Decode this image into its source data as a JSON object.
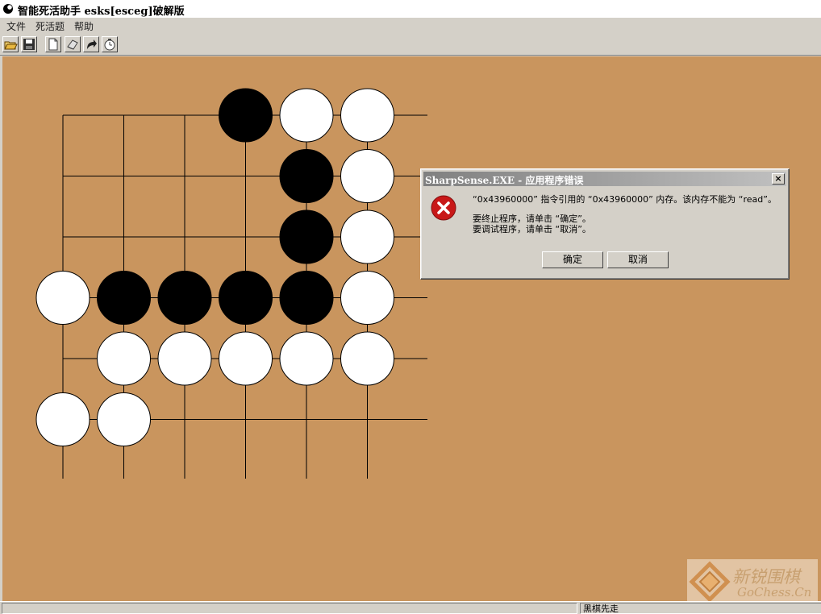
{
  "window": {
    "title": "智能死活助手 esks[esceg]破解版"
  },
  "menu": [
    "文件",
    "死活题",
    "帮助"
  ],
  "toolbar": {
    "buttons": [
      "open-icon",
      "save-icon",
      "new-icon",
      "erase-icon",
      "redo-icon",
      "timer-icon"
    ]
  },
  "board": {
    "background": "#c9955e",
    "stones": [
      {
        "col": 3,
        "row": 0,
        "color": "black"
      },
      {
        "col": 4,
        "row": 0,
        "color": "white"
      },
      {
        "col": 5,
        "row": 0,
        "color": "white"
      },
      {
        "col": 4,
        "row": 1,
        "color": "black"
      },
      {
        "col": 5,
        "row": 1,
        "color": "white"
      },
      {
        "col": 4,
        "row": 2,
        "color": "black"
      },
      {
        "col": 5,
        "row": 2,
        "color": "white"
      },
      {
        "col": 0,
        "row": 3,
        "color": "white"
      },
      {
        "col": 1,
        "row": 3,
        "color": "black"
      },
      {
        "col": 2,
        "row": 3,
        "color": "black"
      },
      {
        "col": 3,
        "row": 3,
        "color": "black"
      },
      {
        "col": 4,
        "row": 3,
        "color": "black"
      },
      {
        "col": 5,
        "row": 3,
        "color": "white"
      },
      {
        "col": 1,
        "row": 4,
        "color": "white"
      },
      {
        "col": 2,
        "row": 4,
        "color": "white"
      },
      {
        "col": 3,
        "row": 4,
        "color": "white"
      },
      {
        "col": 4,
        "row": 4,
        "color": "white"
      },
      {
        "col": 5,
        "row": 4,
        "color": "white"
      },
      {
        "col": 0,
        "row": 5,
        "color": "white"
      },
      {
        "col": 1,
        "row": 5,
        "color": "white"
      }
    ]
  },
  "dialog": {
    "title": "SharpSense.EXE - 应用程序错误",
    "close": "×",
    "line1": "“0x43960000” 指令引用的 “0x43960000” 内存。该内存不能为 “read”。",
    "line2": "要终止程序，请单击 “确定”。",
    "line3": "要调试程序，请单击 “取消”。",
    "ok_label": "确定",
    "cancel_label": "取消"
  },
  "statusbar": {
    "text": "黑棋先走"
  },
  "watermark": {
    "cn": "新锐围棋",
    "en": "GoChess.Cn"
  }
}
